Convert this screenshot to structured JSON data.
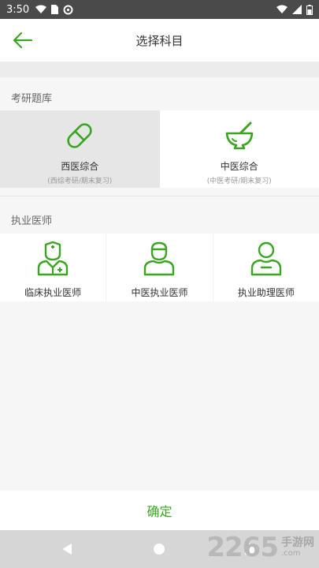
{
  "status_bar": {
    "time": "3:50"
  },
  "app_bar": {
    "title": "选择科目"
  },
  "section_exam": {
    "label": "考研题库",
    "items": [
      {
        "name": "西医综合",
        "sub": "(西综考研/期末复习)",
        "icon": "pill-icon",
        "selected": true
      },
      {
        "name": "中医综合",
        "sub": "(中医考研/期末复习)",
        "icon": "mortar-pestle-icon",
        "selected": false
      }
    ]
  },
  "section_license": {
    "label": "执业医师",
    "items": [
      {
        "name": "临床执业医师",
        "icon": "doctor-icon"
      },
      {
        "name": "中医执业医师",
        "icon": "physician-icon"
      },
      {
        "name": "执业助理医师",
        "icon": "assistant-icon"
      }
    ]
  },
  "confirm_button": {
    "label": "确定"
  },
  "colors": {
    "accent": "#3aa520",
    "selected_bg": "#e6e6e6"
  },
  "watermark": {
    "number": "2265",
    "cn": "手游网",
    "domain": ".com"
  }
}
